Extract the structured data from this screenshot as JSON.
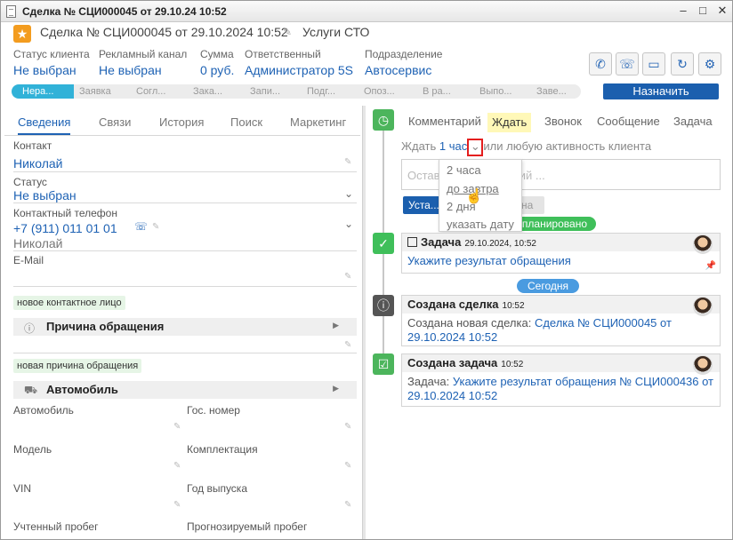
{
  "window": {
    "title": "Сделка № СЦИ000045 от 29.10.24 10:52",
    "min": "‒",
    "max": "□",
    "close": "✕"
  },
  "header": {
    "title": "Сделка № СЦИ000045 от 29.10.2024 10:52",
    "service": "Услуги СТО"
  },
  "fields": [
    {
      "label": "Статус клиента",
      "value": "Не выбран"
    },
    {
      "label": "Рекламный канал",
      "value": "Не выбран"
    },
    {
      "label": "Сумма",
      "value": "0 руб."
    },
    {
      "label": "Ответственный",
      "value": "Администратор 5S"
    },
    {
      "label": "Подразделение",
      "value": "Автосервис"
    }
  ],
  "steps": [
    "Нера...",
    "Заявка",
    "Согл...",
    "Зака...",
    "Запи...",
    "Подг...",
    "Опоз...",
    "В ра...",
    "Выпо...",
    "Заве..."
  ],
  "assign_label": "Назначить",
  "left_tabs": [
    "Сведения",
    "Связи",
    "История",
    "Поиск",
    "Маркетинг"
  ],
  "contact": {
    "label": "Контакт",
    "value": "Николай"
  },
  "status": {
    "label": "Статус",
    "value": "Не выбран"
  },
  "phone": {
    "label": "Контактный телефон",
    "value": "+7 (911) 011 01 01",
    "name": "Николай"
  },
  "email": {
    "label": "E-Mail"
  },
  "tag_new_contact": "новое контактное лицо",
  "reason_section": "Причина обращения",
  "tag_new_reason": "новая причина обращения",
  "car_section": "Автомобиль",
  "car_fields": [
    "Автомобиль",
    "Гос. номер",
    "Модель",
    "Комплектация",
    "VIN",
    "Год выпуска",
    "Учтенный пробег",
    "Прогнозируемый пробег"
  ],
  "right_tabs": [
    "Комментарий",
    "Ждать",
    "Звонок",
    "Сообщение",
    "Задача"
  ],
  "wait": {
    "prefix": "Ждать",
    "value": "1 час",
    "suffix": "или любую активность клиента"
  },
  "comment_placeholder": "Оставить комментарий ...",
  "set_button": "Уста...",
  "cancel_button": "на",
  "planned_badge": "запланировано",
  "dropdown": [
    "2 часа",
    "до завтра",
    "2 дня",
    "указать дату"
  ],
  "task_card": {
    "title": "Задача",
    "time": "29.10.2024, 10:52",
    "link": "Укажите результат обращения"
  },
  "today_badge": "Сегодня",
  "deal_card": {
    "title": "Создана сделка",
    "time": "10:52",
    "text": "Создана новая сделка:",
    "link": "Сделка № СЦИ000045 от 29.10.2024 10:52"
  },
  "task_created_card": {
    "title": "Создана задача",
    "time": "10:52",
    "text": "Задача:",
    "link": "Укажите результат обращения № СЦИ000436 от 29.10.2024 10:52"
  }
}
